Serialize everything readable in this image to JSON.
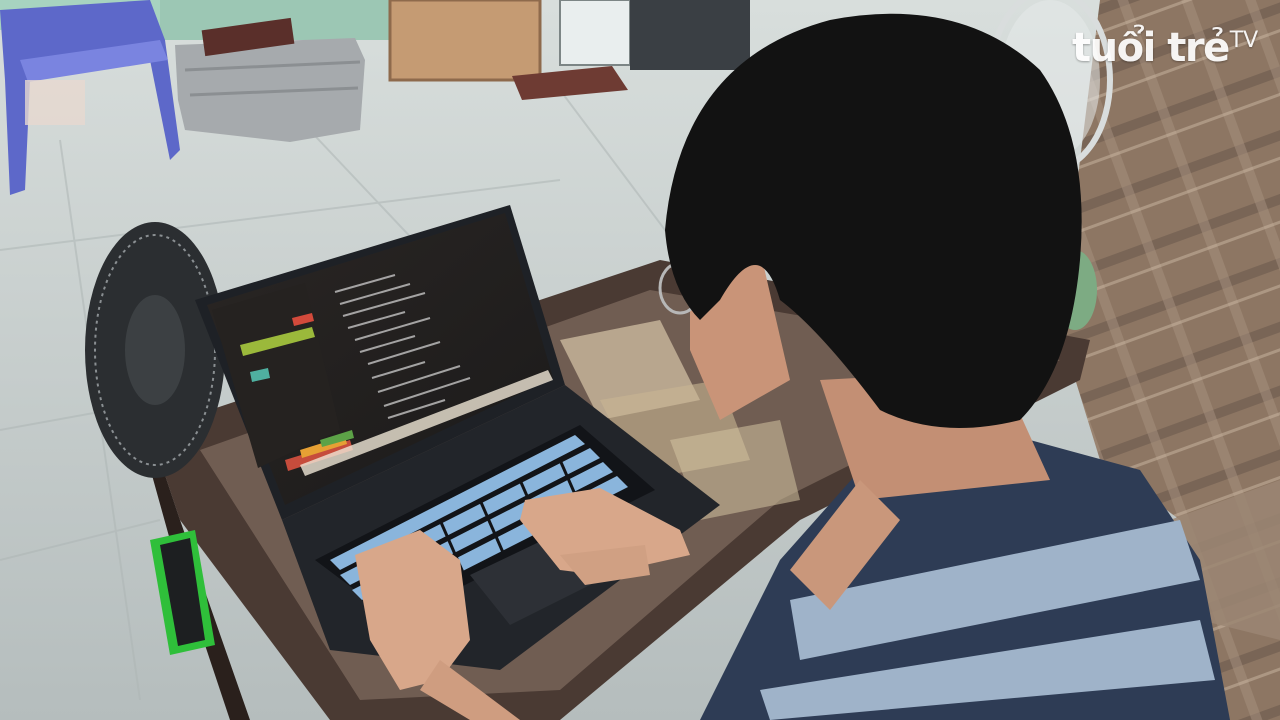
{
  "watermark": {
    "brand": "tuổi trẻ",
    "suffix": "TV"
  },
  "colors": {
    "wall": "#9cc7b4",
    "floor": "#c9d0cf",
    "sofa": "#8c7764",
    "table_glass": "#6b5648",
    "laptop_body": "#1f2227",
    "keyboard_glow": "#a9d8ff",
    "shirt_dark": "#2e3c55",
    "shirt_light": "#9fb3c9",
    "hair": "#121212",
    "skin": "#d8a78a",
    "fan_base_green": "#2fbf3a"
  },
  "icons": [
    "laptop-icon",
    "fan-icon",
    "chair-icon",
    "suitcase-icon",
    "sofa-icon",
    "person-icon"
  ]
}
